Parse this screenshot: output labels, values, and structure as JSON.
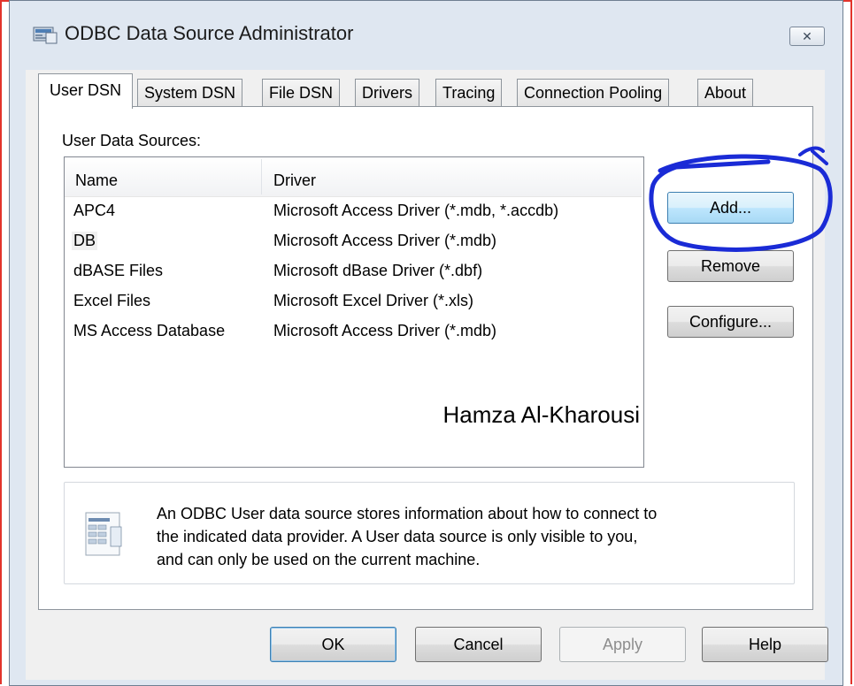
{
  "window": {
    "title": "ODBC Data Source Administrator",
    "close_glyph": "✕"
  },
  "tabs": [
    {
      "label": "User DSN",
      "active": true
    },
    {
      "label": "System DSN"
    },
    {
      "label": "File DSN"
    },
    {
      "label": "Drivers"
    },
    {
      "label": "Tracing"
    },
    {
      "label": "Connection Pooling"
    },
    {
      "label": "About"
    }
  ],
  "panel": {
    "section_label": "User Data Sources:",
    "columns": {
      "name": "Name",
      "driver": "Driver"
    },
    "rows": [
      {
        "name": "APC4",
        "driver": "Microsoft Access Driver (*.mdb, *.accdb)"
      },
      {
        "name": "DB",
        "driver": "Microsoft Access Driver (*.mdb)"
      },
      {
        "name": "dBASE Files",
        "driver": "Microsoft dBase Driver (*.dbf)"
      },
      {
        "name": "Excel Files",
        "driver": "Microsoft Excel Driver (*.xls)"
      },
      {
        "name": "MS Access Database",
        "driver": "Microsoft Access Driver (*.mdb)"
      }
    ],
    "watermark": "Hamza Al-Kharousi",
    "buttons": {
      "add": "Add...",
      "remove": "Remove",
      "configure": "Configure..."
    },
    "info": {
      "line1": "An ODBC User data source stores information about how to connect to",
      "line2": "the indicated data provider.   A User data source is only visible to you,",
      "line3": "and can only be used on the current machine."
    }
  },
  "footer": {
    "ok": "OK",
    "cancel": "Cancel",
    "apply": "Apply",
    "help": "Help"
  },
  "colors": {
    "accent": "#3c7fb1",
    "annotation": "#1a2bd6",
    "frame": "#e2342c"
  }
}
